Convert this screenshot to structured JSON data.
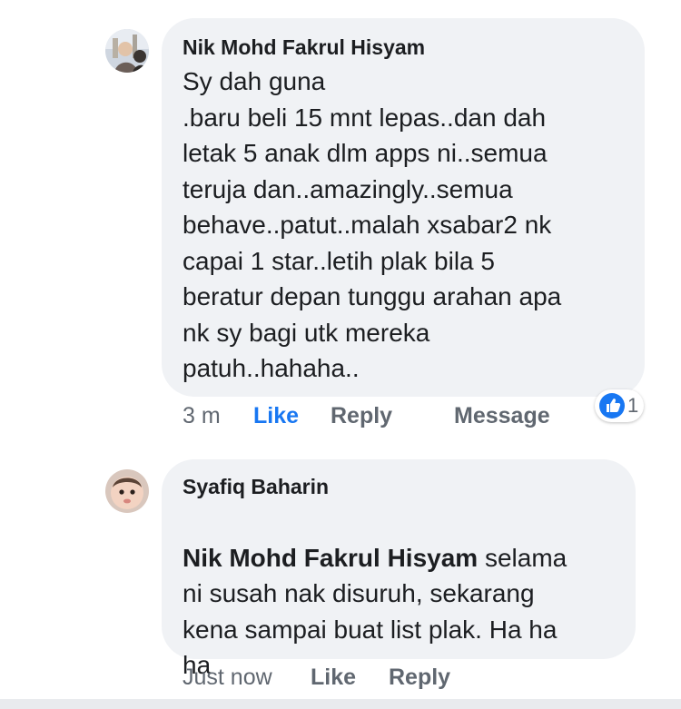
{
  "comments": [
    {
      "author": "Nik Mohd Fakrul Hisyam",
      "text": "Sy dah guna\n.baru beli 15 mnt lepas..dan dah\nletak 5 anak dlm apps ni..semua\nteruja dan..amazingly..semua\nbehave..patut..malah xsabar2 nk\ncapai 1 star..letih plak bila 5\nberatur depan tunggu arahan apa\nnk sy bagi utk mereka\npatuh..hahaha..",
      "time": "3 m",
      "like_label": "Like",
      "reply_label": "Reply",
      "message_label": "Message",
      "reaction_count": "1",
      "reaction_icon": "thumbs-up-icon"
    },
    {
      "author": "Syafiq Baharin",
      "mention": "Nik Mohd Fakrul Hisyam",
      "text_line1": " selama",
      "text_rest": "ni susah nak disuruh, sekarang\nkena sampai buat list plak. Ha ha\nha",
      "time": "Just now",
      "like_label": "Like",
      "reply_label": "Reply"
    }
  ],
  "colors": {
    "bubble": "#f0f2f5",
    "text": "#1c1e21",
    "meta": "#606770",
    "like_active": "#1877f2"
  }
}
